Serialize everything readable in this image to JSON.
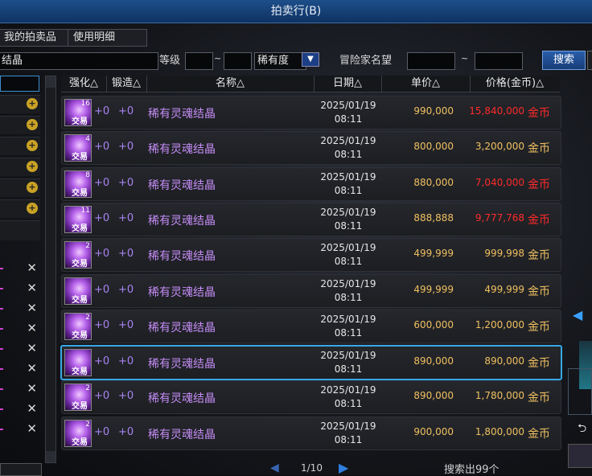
{
  "window": {
    "title": "拍卖行(B)"
  },
  "tabs": {
    "my_items": "我的拍卖品",
    "usage": "使用明细"
  },
  "search": {
    "keyword": "结晶",
    "level_label": "等级",
    "level_min": "",
    "range_sep": "~",
    "level_max": "",
    "rarity_label": "稀有度",
    "reputation_label": "冒险家名望",
    "rep_min": "",
    "rep_max": "",
    "search_button": "搜索"
  },
  "table": {
    "headers": {
      "enhance": "强化△",
      "forge": "锻造△",
      "name": "名称△",
      "date": "日期△",
      "unit_price": "单价△",
      "price": "价格(金币)△"
    },
    "rows": [
      {
        "count": "16",
        "trade": "交易",
        "enhance": "+0",
        "forge": "+0",
        "name": "稀有灵魂结晶",
        "date": "2025/01/19",
        "time": "08:11",
        "unit_price": "990,000",
        "price": "15,840,000",
        "currency": "金币",
        "price_color": "#ff2a2a"
      },
      {
        "count": "4",
        "trade": "交易",
        "enhance": "+0",
        "forge": "+0",
        "name": "稀有灵魂结晶",
        "date": "2025/01/19",
        "time": "08:11",
        "unit_price": "800,000",
        "price": "3,200,000",
        "currency": "金币",
        "price_color": "#f0c060"
      },
      {
        "count": "8",
        "trade": "交易",
        "enhance": "+0",
        "forge": "+0",
        "name": "稀有灵魂结晶",
        "date": "2025/01/19",
        "time": "08:11",
        "unit_price": "880,000",
        "price": "7,040,000",
        "currency": "金币",
        "price_color": "#ff2a2a"
      },
      {
        "count": "11",
        "trade": "交易",
        "enhance": "+0",
        "forge": "+0",
        "name": "稀有灵魂结晶",
        "date": "2025/01/19",
        "time": "08:11",
        "unit_price": "888,888",
        "price": "9,777,768",
        "currency": "金币",
        "price_color": "#ff2a2a"
      },
      {
        "count": "2",
        "trade": "交易",
        "enhance": "+0",
        "forge": "+0",
        "name": "稀有灵魂结晶",
        "date": "2025/01/19",
        "time": "08:11",
        "unit_price": "499,999",
        "price": "999,998",
        "currency": "金币",
        "price_color": "#f0c060"
      },
      {
        "count": "",
        "trade": "交易",
        "enhance": "+0",
        "forge": "+0",
        "name": "稀有灵魂结晶",
        "date": "2025/01/19",
        "time": "08:11",
        "unit_price": "499,999",
        "price": "499,999",
        "currency": "金币",
        "price_color": "#f0c060"
      },
      {
        "count": "2",
        "trade": "交易",
        "enhance": "+0",
        "forge": "+0",
        "name": "稀有灵魂结晶",
        "date": "2025/01/19",
        "time": "08:11",
        "unit_price": "600,000",
        "price": "1,200,000",
        "currency": "金币",
        "price_color": "#f0c060"
      },
      {
        "count": "",
        "trade": "交易",
        "enhance": "+0",
        "forge": "+0",
        "name": "稀有灵魂结晶",
        "date": "2025/01/19",
        "time": "08:11",
        "unit_price": "890,000",
        "price": "890,000",
        "currency": "金币",
        "price_color": "#f0c060",
        "selected": true
      },
      {
        "count": "2",
        "trade": "交易",
        "enhance": "+0",
        "forge": "+0",
        "name": "稀有灵魂结晶",
        "date": "2025/01/19",
        "time": "08:11",
        "unit_price": "890,000",
        "price": "1,780,000",
        "currency": "金币",
        "price_color": "#f0c060"
      },
      {
        "count": "2",
        "trade": "交易",
        "enhance": "+0",
        "forge": "+0",
        "name": "稀有灵魂结晶",
        "date": "2025/01/19",
        "time": "08:11",
        "unit_price": "900,000",
        "price": "1,800,000",
        "currency": "金币",
        "price_color": "#f0c060"
      }
    ]
  },
  "pagination": {
    "page_info": "1/10",
    "result_count": "搜索出99个"
  },
  "colors": {
    "accent": "#38a7e6",
    "title_bar": "#1d4f8a",
    "item_name": "#c48cf5",
    "gold": "#f0c060",
    "red_price": "#ff2a2a"
  },
  "icons": {
    "zoom": "magnifier-plus-icon",
    "close": "close-icon",
    "dropdown": "chevron-down-icon",
    "prev": "prev-page-icon",
    "next": "next-page-icon",
    "item": "soul-crystal-icon"
  }
}
